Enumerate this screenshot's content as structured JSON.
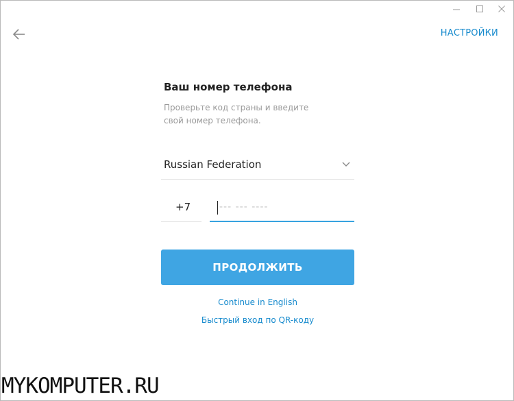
{
  "window": {
    "minimize_icon": "minimize-icon",
    "maximize_icon": "maximize-icon",
    "close_icon": "close-icon"
  },
  "header": {
    "back_icon": "arrow-left-icon",
    "settings_label": "НАСТРОЙКИ"
  },
  "form": {
    "title": "Ваш номер телефона",
    "description": "Проверьте код страны и введите свой номер телефона.",
    "country": {
      "selected": "Russian Federation",
      "icon": "chevron-down-icon"
    },
    "phone": {
      "code": "+7",
      "value": "",
      "placeholder": "--- --- ----"
    },
    "continue_label": "ПРОДОЛЖИТЬ",
    "link_english": "Continue in English",
    "link_qr": "Быстрый вход по QR-коду"
  },
  "colors": {
    "accent": "#3fa5e3",
    "link": "#168acd",
    "title_text": "#222222",
    "muted_text": "#999999"
  },
  "watermark": "MYKOMPUTER.RU"
}
